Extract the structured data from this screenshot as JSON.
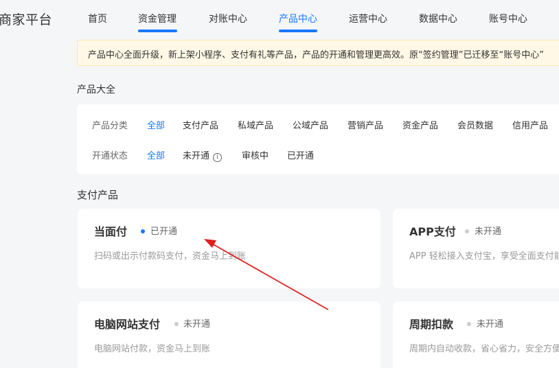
{
  "header": {
    "brand": "商家平台",
    "nav": [
      {
        "label": "首页",
        "active": false
      },
      {
        "label": "资金管理",
        "active": false
      },
      {
        "label": "对账中心",
        "active": false
      },
      {
        "label": "产品中心",
        "active": true
      },
      {
        "label": "运营中心",
        "active": false
      },
      {
        "label": "数据中心",
        "active": false
      },
      {
        "label": "账号中心",
        "active": false
      }
    ]
  },
  "notice": {
    "text": "产品中心全面升级，新上架小程序、支付有礼等产品，产品的开通和管理更高效。原“签约管理”已迁移至“账号中心”"
  },
  "catalog": {
    "title": "产品大全",
    "category_row": {
      "label": "产品分类",
      "options": [
        "全部",
        "支付产品",
        "私域产品",
        "公域产品",
        "营销产品",
        "资金产品",
        "会员数据",
        "信用产品"
      ],
      "selected": "全部"
    },
    "status_row": {
      "label": "开通状态",
      "options": [
        "全部",
        "未开通",
        "审核中",
        "已开通"
      ],
      "selected": "全部"
    }
  },
  "payment_section": {
    "title": "支付产品",
    "cards": [
      {
        "title": "当面付",
        "status": "已开通",
        "status_color": "#1677ff",
        "desc": "扫码或出示付款码支付，资金马上到账"
      },
      {
        "title": "APP支付",
        "status": "未开通",
        "status_color": "#cccccc",
        "desc": "APP 轻松接入支付宝，享受全面支付能力"
      },
      {
        "title": "电脑网站支付",
        "status": "未开通",
        "status_color": "#cccccc",
        "desc": "电脑网站付款，资金马上到账"
      },
      {
        "title": "周期扣款",
        "status": "未开通",
        "status_color": "#cccccc",
        "desc": "周期内自动收款，省心省力，安全方便"
      }
    ]
  },
  "colors": {
    "accent": "#1677ff",
    "annotation_arrow": "#e02020",
    "notice_bg": "#fff8e6"
  }
}
